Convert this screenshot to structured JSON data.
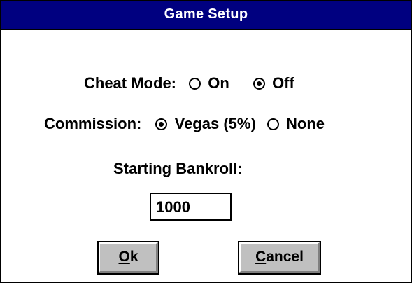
{
  "dialog": {
    "title": "Game Setup"
  },
  "cheat_mode": {
    "label": "Cheat Mode:",
    "options": [
      {
        "label": "On",
        "selected": false
      },
      {
        "label": "Off",
        "selected": true
      }
    ]
  },
  "commission": {
    "label": "Commission:",
    "options": [
      {
        "label": "Vegas (5%)",
        "selected": true
      },
      {
        "label": "None",
        "selected": false
      }
    ]
  },
  "bankroll": {
    "label": "Starting Bankroll:",
    "value": "1000"
  },
  "buttons": {
    "ok_mnemonic": "O",
    "ok_rest": "k",
    "cancel_mnemonic": "C",
    "cancel_rest": "ancel"
  },
  "colors": {
    "titlebar": "#000080",
    "button_face": "#c0c0c0"
  }
}
